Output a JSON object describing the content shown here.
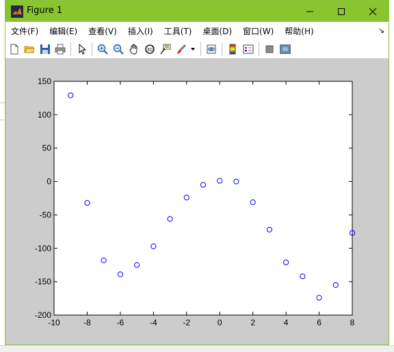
{
  "window": {
    "title": "Figure 1",
    "title_color": "#89c52e"
  },
  "menu": [
    {
      "label": "文件(F)"
    },
    {
      "label": "编辑(E)"
    },
    {
      "label": "查看(V)"
    },
    {
      "label": "插入(I)"
    },
    {
      "label": "工具(T)"
    },
    {
      "label": "桌面(D)"
    },
    {
      "label": "窗口(W)"
    },
    {
      "label": "帮助(H)"
    }
  ],
  "toolbar": [
    "new-figure-icon",
    "open-file-icon",
    "save-icon",
    "print-icon",
    "edit-plot-arrow-icon",
    "zoom-in-icon",
    "zoom-out-icon",
    "pan-hand-icon",
    "rotate-3d-icon",
    "data-cursor-icon",
    "brush-icon",
    "link-plot-icon",
    "insert-colorbar-icon",
    "insert-legend-icon",
    "hide-plot-tools-icon",
    "show-plot-tools-icon"
  ],
  "chart_data": {
    "type": "scatter",
    "marker": "circle",
    "marker_color": "#0000ff",
    "xlim": [
      -10,
      8
    ],
    "ylim": [
      -200,
      150
    ],
    "xticks": [
      -10,
      -8,
      -6,
      -4,
      -2,
      0,
      2,
      4,
      6,
      8
    ],
    "yticks": [
      150,
      100,
      50,
      0,
      -50,
      -100,
      -150,
      -200
    ],
    "grid": false,
    "x": [
      -9,
      -8,
      -7,
      -6,
      -5,
      -4,
      -3,
      -2,
      -1,
      0,
      1,
      2,
      3,
      4,
      5,
      6,
      7,
      8
    ],
    "y": [
      129,
      -32,
      -118,
      -139,
      -125,
      -97,
      -56,
      -24,
      -5,
      1,
      0,
      -31,
      -72,
      -121,
      -142,
      -174,
      -155,
      -77
    ]
  }
}
